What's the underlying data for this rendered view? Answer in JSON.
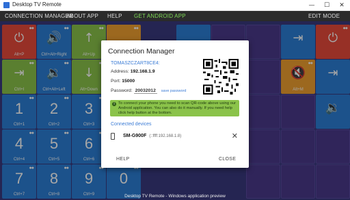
{
  "window": {
    "title": "Desktop TV Remote",
    "minimize": "—",
    "maximize": "☐",
    "close": "✕"
  },
  "menu": {
    "connection_manager": "CONNECTION MANAGER",
    "about_app": "ABOUT APP",
    "help": "HELP",
    "get_android_app": "GET ANDROID APP",
    "edit_mode": "EDIT MODE"
  },
  "tiles": [
    {
      "name": "power",
      "glyph": "⏻",
      "cap": "Alt+P",
      "color": "#e84a3b"
    },
    {
      "name": "volume-up",
      "glyph": "🔊",
      "cap": "Ctrl+Alt+Right",
      "color": "#2b7fd6"
    },
    {
      "name": "arrow-up",
      "glyph": "↑",
      "cap": "Alt+Up",
      "color": "#8bc34a"
    },
    {
      "name": "input-top",
      "glyph": "⎆",
      "cap": "",
      "color": "#f0a030"
    },
    {
      "name": "input",
      "glyph": "⇥",
      "cap": "Ctrl+I",
      "color": "#8bc34a"
    },
    {
      "name": "volume-down",
      "glyph": "🔉",
      "cap": "Ctrl+Alt+Left",
      "color": "#2b7fd6"
    },
    {
      "name": "arrow-down",
      "glyph": "↓",
      "cap": "Alt+Down",
      "color": "#8bc34a"
    },
    {
      "name": "mute",
      "glyph": "🔇",
      "cap": "Alt+M",
      "color": "#f0a030"
    },
    {
      "name": "power-right",
      "glyph": "⏻",
      "cap": "",
      "color": "#e84a3b"
    },
    {
      "name": "input-right",
      "glyph": "⇥",
      "cap": "",
      "color": "#2b7fd6"
    },
    {
      "name": "volume-right",
      "glyph": "🔉",
      "cap": "",
      "color": "#2b7fd6"
    }
  ],
  "numpad": [
    {
      "num": "1",
      "cap": "Ctrl+1"
    },
    {
      "num": "2",
      "cap": "Ctrl+2"
    },
    {
      "num": "3",
      "cap": "Ctrl+3"
    },
    {
      "num": "4",
      "cap": "Ctrl+4"
    },
    {
      "num": "5",
      "cap": "Ctrl+5"
    },
    {
      "num": "6",
      "cap": "Ctrl+6"
    },
    {
      "num": "7",
      "cap": "Ctrl+7"
    },
    {
      "num": "8",
      "cap": "Ctrl+8"
    },
    {
      "num": "9",
      "cap": "Ctrl+9"
    },
    {
      "num": "0",
      "cap": ""
    }
  ],
  "dialog": {
    "title": "Connection Manager",
    "device_id": "TOMASZCZART8CE4:",
    "address_label": "Address:",
    "address_value": "192.168.1.9",
    "port_label": "Port:",
    "port_value": "15000",
    "password_label": "Password:",
    "password_value": "20032012",
    "save_password": "save password",
    "note": "To connect your phone you need to scan QR-code above using our Android application. You can also do it manually. If you need help click help button at the bottom.",
    "connected_devices": "Connected devices",
    "device_name": "SM-G900F",
    "device_address": "(::ffff:192.168.1.8)",
    "help_button": "HELP",
    "close_button": "CLOSE"
  },
  "footer": "Desktop TV Remote - Windows application preview",
  "colors": {
    "accent_blue": "#3a7bd5",
    "note_green": "#8bc34a",
    "android_green": "#7ed957",
    "power_red": "#e84a3b"
  }
}
